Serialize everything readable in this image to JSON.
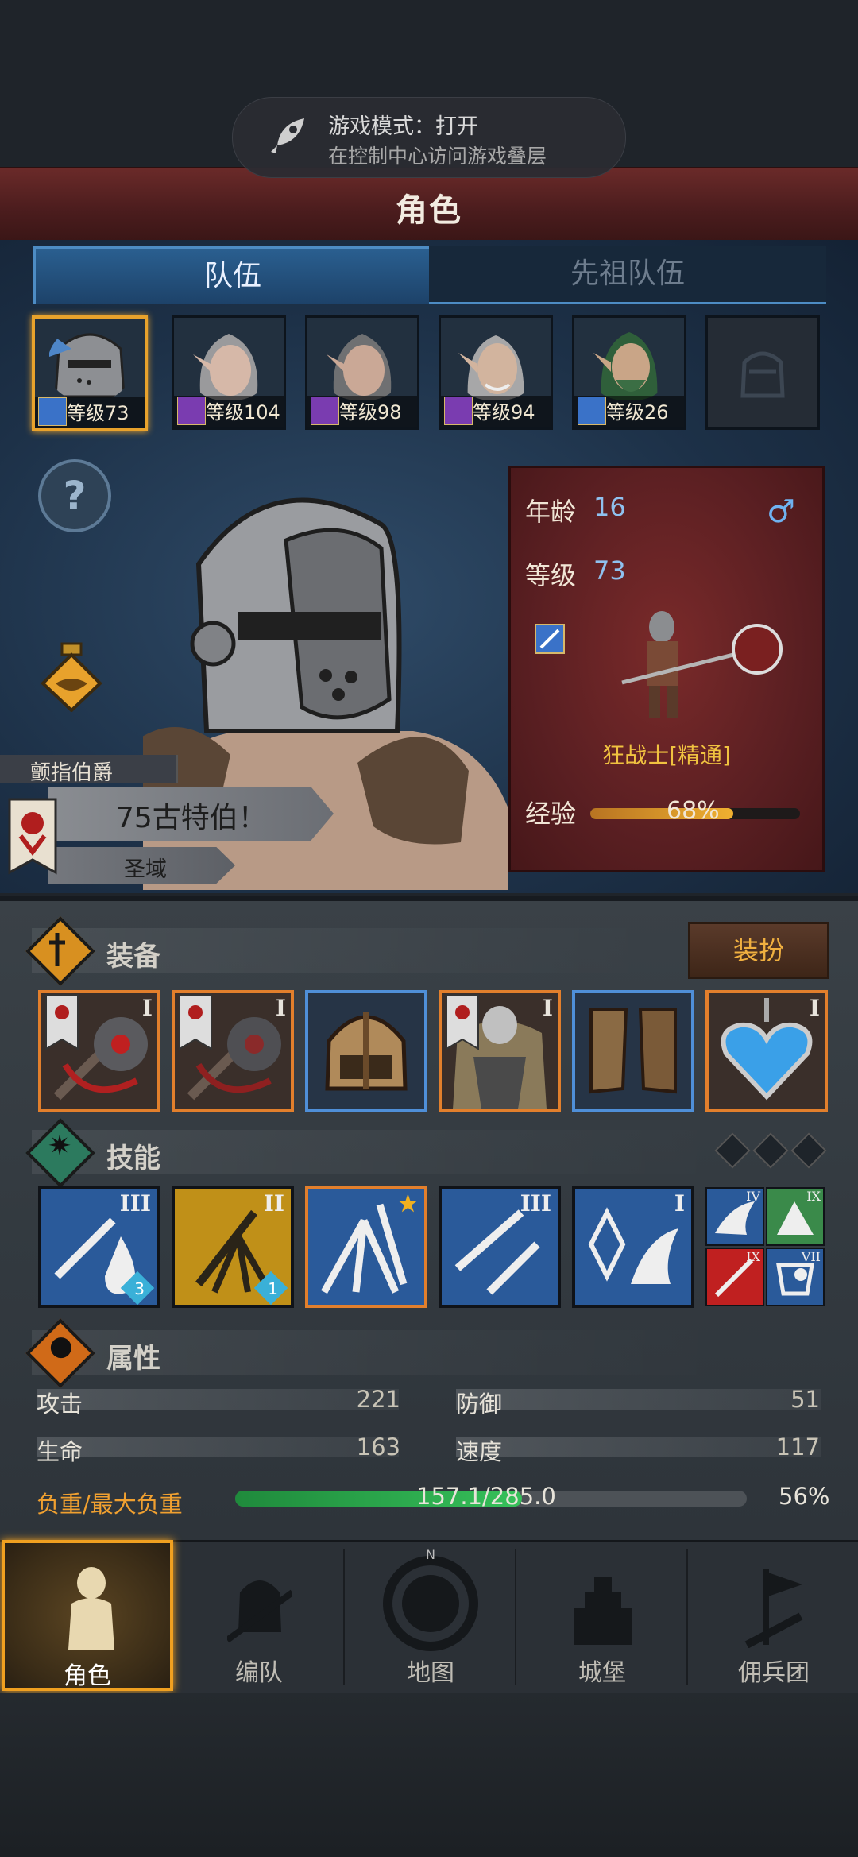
{
  "toast": {
    "line1": "游戏模式：打开",
    "line2": "在控制中心访问游戏叠层"
  },
  "header": {
    "title": "角色"
  },
  "tabs": [
    {
      "label": "队伍"
    },
    {
      "label": "先祖队伍"
    }
  ],
  "party": [
    {
      "level_label": "等级73",
      "class_color": "#3a72c8",
      "selected": true
    },
    {
      "level_label": "等级104",
      "class_color": "#7a3cb0"
    },
    {
      "level_label": "等级98",
      "class_color": "#7a3cb0"
    },
    {
      "level_label": "等级94",
      "class_color": "#7a3cb0"
    },
    {
      "level_label": "等级26",
      "class_color": "#3a72c8"
    }
  ],
  "hero": {
    "rank": "颤指伯爵",
    "name": "75古特伯！",
    "realm": "圣域"
  },
  "stats_card": {
    "age_label": "年龄",
    "age": "16",
    "level_label": "等级",
    "level": "73",
    "gender_icon": "male-icon",
    "class_title": "狂战士[精通]",
    "xp_label": "经验",
    "xp_percent_text": "68%",
    "xp_fraction": 0.68
  },
  "equipment": {
    "title": "装备",
    "dress_button": "装扮",
    "slots": [
      {
        "tier": "I",
        "rarity": "orange",
        "item": "mace"
      },
      {
        "tier": "I",
        "rarity": "orange",
        "item": "mace"
      },
      {
        "tier": "",
        "rarity": "blue",
        "item": "helmet"
      },
      {
        "tier": "I",
        "rarity": "orange",
        "item": "armor"
      },
      {
        "tier": "",
        "rarity": "blue",
        "item": "boots"
      },
      {
        "tier": "I",
        "rarity": "orange",
        "item": "amulet"
      }
    ]
  },
  "skills": {
    "title": "技能",
    "list": [
      {
        "tier": "III",
        "gem": "3"
      },
      {
        "tier": "II",
        "gem": "1"
      },
      {
        "tier": "★",
        "gem": ""
      },
      {
        "tier": "III",
        "gem": ""
      },
      {
        "tier": "I",
        "gem": ""
      }
    ],
    "mini": [
      {
        "tier": "IV"
      },
      {
        "tier": "IX"
      },
      {
        "tier": "IX"
      },
      {
        "tier": "VII"
      }
    ]
  },
  "attributes": {
    "title": "属性",
    "attack_label": "攻击",
    "attack": "221",
    "defense_label": "防御",
    "defense": "51",
    "hp_label": "生命",
    "hp": "163",
    "speed_label": "速度",
    "speed": "117",
    "load_label": "负重/最大负重",
    "load_text": "157.1/285.0",
    "load_percent": "56%",
    "load_fraction": 0.56
  },
  "nav": [
    {
      "label": "角色",
      "active": true
    },
    {
      "label": "编队"
    },
    {
      "label": "地图"
    },
    {
      "label": "城堡"
    },
    {
      "label": "佣兵团"
    }
  ]
}
